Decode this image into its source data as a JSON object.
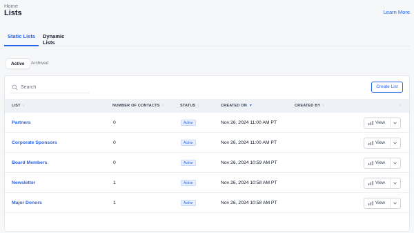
{
  "breadcrumb": "Home",
  "page_title": "Lists",
  "learn_more": "Learn More",
  "tabs": [
    {
      "label": "Static Lists"
    },
    {
      "label": "Dynamic Lists"
    }
  ],
  "sub_tabs": [
    {
      "label": "Active"
    },
    {
      "label": "Archived"
    }
  ],
  "search": {
    "placeholder": "Search"
  },
  "create_button": "Create List",
  "columns": [
    "LIST",
    "NUMBER OF CONTACTS",
    "STATUS",
    "CREATED ON",
    "CREATED BY"
  ],
  "rows": [
    {
      "name": "Partners",
      "contacts": "0",
      "status": "Active",
      "created_on": "Nov 26, 2024 11:00 AM PT",
      "created_by": ""
    },
    {
      "name": "Corporate Sponsors",
      "contacts": "0",
      "status": "Active",
      "created_on": "Nov 26, 2024 11:00 AM PT",
      "created_by": ""
    },
    {
      "name": "Board Members",
      "contacts": "0",
      "status": "Active",
      "created_on": "Nov 26, 2024 10:59 AM PT",
      "created_by": ""
    },
    {
      "name": "Newsletter",
      "contacts": "1",
      "status": "Active",
      "created_on": "Nov 26, 2024 10:58 AM PT",
      "created_by": ""
    },
    {
      "name": "Major Donors",
      "contacts": "1",
      "status": "Active",
      "created_on": "Nov 26, 2024 10:58 AM PT",
      "created_by": ""
    }
  ],
  "row_action": "View",
  "colors": {
    "accent": "#2563eb",
    "background": "#f6f7f9",
    "header_bg": "#eef1f5"
  }
}
